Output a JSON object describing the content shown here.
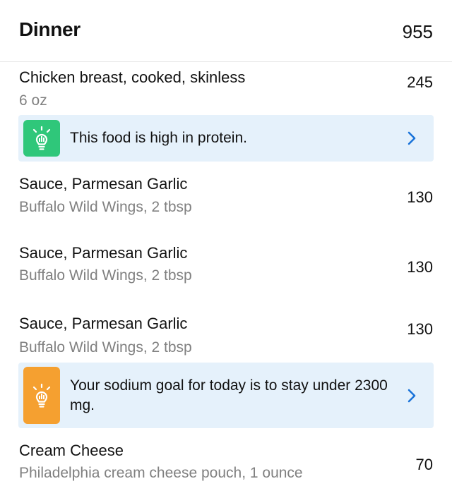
{
  "section": {
    "title": "Dinner",
    "total": "955"
  },
  "items": [
    {
      "name": "Chicken breast, cooked, skinless",
      "detail": "6 oz",
      "calories": "245"
    },
    {
      "name": "Sauce, Parmesan Garlic",
      "detail": "Buffalo Wild Wings, 2 tbsp",
      "calories": "130"
    },
    {
      "name": "Sauce, Parmesan Garlic",
      "detail": "Buffalo Wild Wings, 2 tbsp",
      "calories": "130"
    },
    {
      "name": "Sauce, Parmesan Garlic",
      "detail": "Buffalo Wild Wings, 2 tbsp",
      "calories": "130"
    },
    {
      "name": "Cream Cheese",
      "detail": "Philadelphia cream cheese pouch, 1 ounce",
      "calories": "70"
    }
  ],
  "tips": [
    {
      "text": "This food is high in protein.",
      "icon": "lightbulb-icon",
      "color": "#2fc77a"
    },
    {
      "text": "Your sodium goal for today is to stay under 2300 mg.",
      "icon": "lightbulb-icon",
      "color": "#f5a030"
    }
  ],
  "colors": {
    "accent": "#1a73d9",
    "tip_background": "#e5f1fb",
    "secondary_text": "#808080"
  }
}
